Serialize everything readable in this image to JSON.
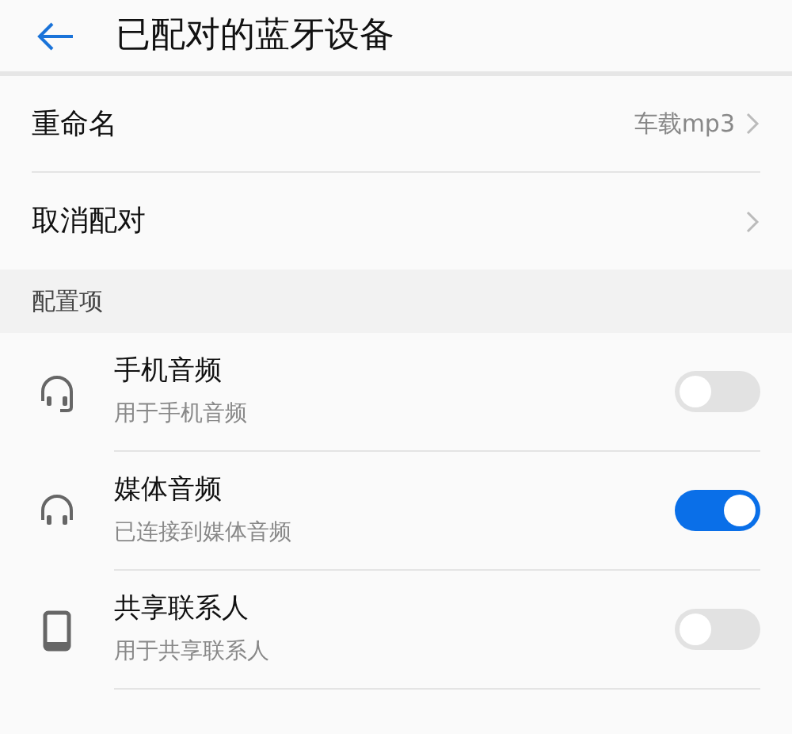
{
  "header": {
    "title": "已配对的蓝牙设备"
  },
  "actions": [
    {
      "label": "重命名",
      "value": "车载mp3"
    },
    {
      "label": "取消配对"
    }
  ],
  "section": {
    "title": "配置项"
  },
  "profiles": [
    {
      "kind": "headset",
      "title": "手机音频",
      "subtitle": "用于手机音频",
      "on": false
    },
    {
      "kind": "headphones",
      "title": "媒体音频",
      "subtitle": "已连接到媒体音频",
      "on": true
    },
    {
      "kind": "phone",
      "title": "共享联系人",
      "subtitle": "用于共享联系人",
      "on": false
    }
  ]
}
